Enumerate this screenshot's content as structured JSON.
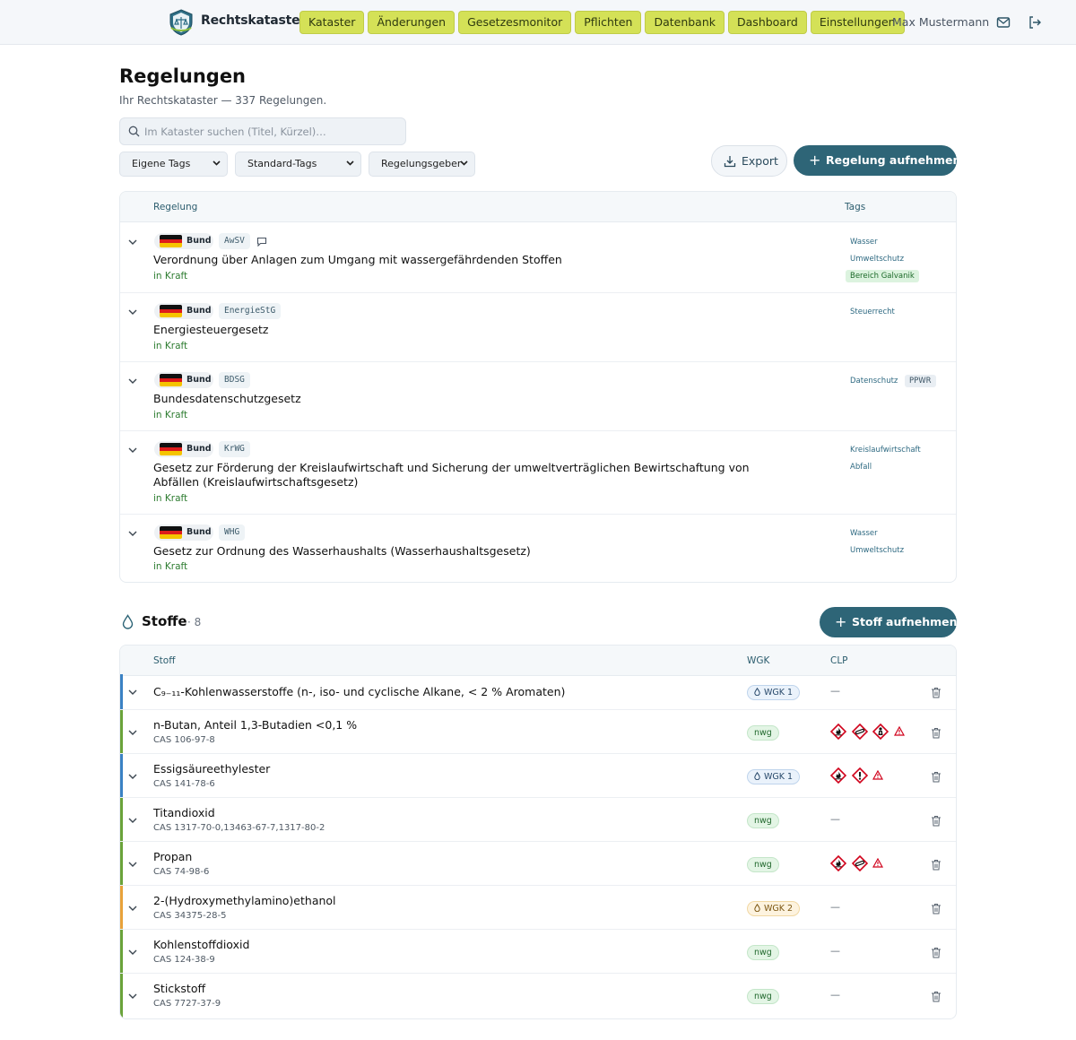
{
  "header": {
    "app_name": "Rechtskataster",
    "nav": [
      "Kataster",
      "Änderungen",
      "Gesetzesmonitor",
      "Pflichten",
      "Datenbank",
      "Dashboard",
      "Einstellungen"
    ],
    "user_name": "Max Mustermann"
  },
  "page": {
    "title": "Regelungen",
    "subtitle": "Ihr Rechtskataster — 337 Regelungen.",
    "search_placeholder": "Im Kataster suchen (Titel, Kürzel)…"
  },
  "filters": [
    "Eigene Tags",
    "Standard-Tags",
    "Regelungsgeber"
  ],
  "actions": {
    "export": "Export",
    "add_regulation": "Regelung aufnehmen"
  },
  "regulations": {
    "header": {
      "col_regelung": "Regelung",
      "col_tags": "Tags"
    },
    "rows": [
      {
        "jurisdiction": "Bund",
        "abbr": "AwSV",
        "title": "Verordnung über Anlagen zum Umgang mit wassergefährdenden Stoffen",
        "status": "in Kraft",
        "tags": [
          "Wasser",
          "Umweltschutz",
          "Bereich Galvanik"
        ]
      },
      {
        "jurisdiction": "Bund",
        "abbr": "EnergieStG",
        "title": "Energiesteuergesetz",
        "status": "in Kraft",
        "tags": [
          "Steuerrecht"
        ]
      },
      {
        "jurisdiction": "Bund",
        "abbr": "BDSG",
        "title": "Bundesdatenschutzgesetz",
        "status": "in Kraft",
        "tags": [
          "Datenschutz",
          "PPWR"
        ]
      },
      {
        "jurisdiction": "Bund",
        "abbr": "KrWG",
        "title": "Gesetz zur Förderung der Kreislaufwirtschaft und Sicherung der umweltverträglichen Bewirtschaftung von Abfällen (Kreislaufwirtschaftsgesetz)",
        "status": "in Kraft",
        "tags": [
          "Kreislaufwirtschaft",
          "Abfall"
        ]
      },
      {
        "jurisdiction": "Bund",
        "abbr": "WHG",
        "title": "Gesetz zur Ordnung des Wasserhaushalts (Wasserhaushaltsgesetz)",
        "status": "in Kraft",
        "tags": [
          "Wasser",
          "Umweltschutz"
        ]
      }
    ]
  },
  "substances": {
    "title": "Stoffe",
    "count": "· 8",
    "add_button": "Stoff aufnehmen",
    "header": {
      "col_stoff": "Stoff",
      "col_wgk": "WGK",
      "col_clp": "CLP"
    },
    "rows": [
      {
        "name": "C₉₋₁₁-Kohlenwasserstoffe (n-, iso- und cyclische Alkane, < 2 % Aromaten)",
        "cas": "",
        "wgk": "WGK 1",
        "wgk_class": "w1",
        "bar_color": "#3b82c4",
        "clp": [],
        "clp_empty": "—"
      },
      {
        "name": "n-Butan, Anteil 1,3-Butadien <0,1 %",
        "cas": "CAS 106-97-8",
        "wgk": "nwg",
        "wgk_class": "nwg",
        "bar_color": "#6aa33a",
        "clp": [
          "flame-pictogram",
          "gas-cylinder-pictogram",
          "health-hazard-pictogram",
          "warning-triangle"
        ],
        "clp_empty": ""
      },
      {
        "name": "Essigsäureethylester",
        "cas": "CAS 141-78-6",
        "wgk": "WGK 1",
        "wgk_class": "w1",
        "bar_color": "#3b82c4",
        "clp": [
          "flame-pictogram",
          "exclamation-pictogram",
          "warning-triangle"
        ],
        "clp_empty": ""
      },
      {
        "name": "Titandioxid",
        "cas": "CAS 1317-70-0,13463-67-7,1317-80-2",
        "wgk": "nwg",
        "wgk_class": "nwg",
        "bar_color": "#6aa33a",
        "clp": [],
        "clp_empty": "—"
      },
      {
        "name": "Propan",
        "cas": "CAS 74-98-6",
        "wgk": "nwg",
        "wgk_class": "nwg",
        "bar_color": "#6aa33a",
        "clp": [
          "flame-pictogram",
          "gas-cylinder-pictogram",
          "warning-triangle"
        ],
        "clp_empty": ""
      },
      {
        "name": "2-(Hydroxymethylamino)ethanol",
        "cas": "CAS 34375-28-5",
        "wgk": "WGK 2",
        "wgk_class": "w2",
        "bar_color": "#e8a23a",
        "clp": [],
        "clp_empty": "—"
      },
      {
        "name": "Kohlenstoffdioxid",
        "cas": "CAS 124-38-9",
        "wgk": "nwg",
        "wgk_class": "nwg",
        "bar_color": "#6aa33a",
        "clp": [],
        "clp_empty": "—"
      },
      {
        "name": "Stickstoff",
        "cas": "CAS 7727-37-9",
        "wgk": "nwg",
        "wgk_class": "nwg",
        "bar_color": "#6aa33a",
        "clp": [],
        "clp_empty": "—"
      }
    ]
  },
  "colors": {
    "accent_nav": "#d4e157",
    "primary": "#2e6577",
    "status_green": "#2f7d32"
  }
}
